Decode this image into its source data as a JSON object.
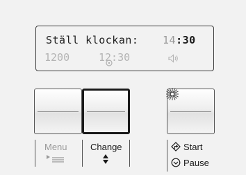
{
  "display": {
    "message": "Ställ klockan:",
    "current_time_hours": "14",
    "current_time_separator": ":",
    "current_time_minutes": "30",
    "temperature": "1200",
    "time_secondary": "12:30",
    "speaker_icon": "speaker-icon",
    "cook_icon": "timer-icon"
  },
  "buttons": {
    "menu": {
      "label": "Menu",
      "sub_icon": "menu-list-icon"
    },
    "change": {
      "label": "Change",
      "sub_icon": "up-down-arrows-icon"
    },
    "start": {
      "start_label": "Start",
      "pause_label": "Pause",
      "start_icon": "diamond-arrow-icon",
      "pause_icon": "circle-chevron-icon",
      "indicator": "light-sparkle-icon"
    }
  },
  "colors": {
    "panel_bg": "#f2f2f2",
    "text_dark": "#1a1a1a",
    "text_dim": "#999999",
    "border": "#3a3a3a"
  }
}
